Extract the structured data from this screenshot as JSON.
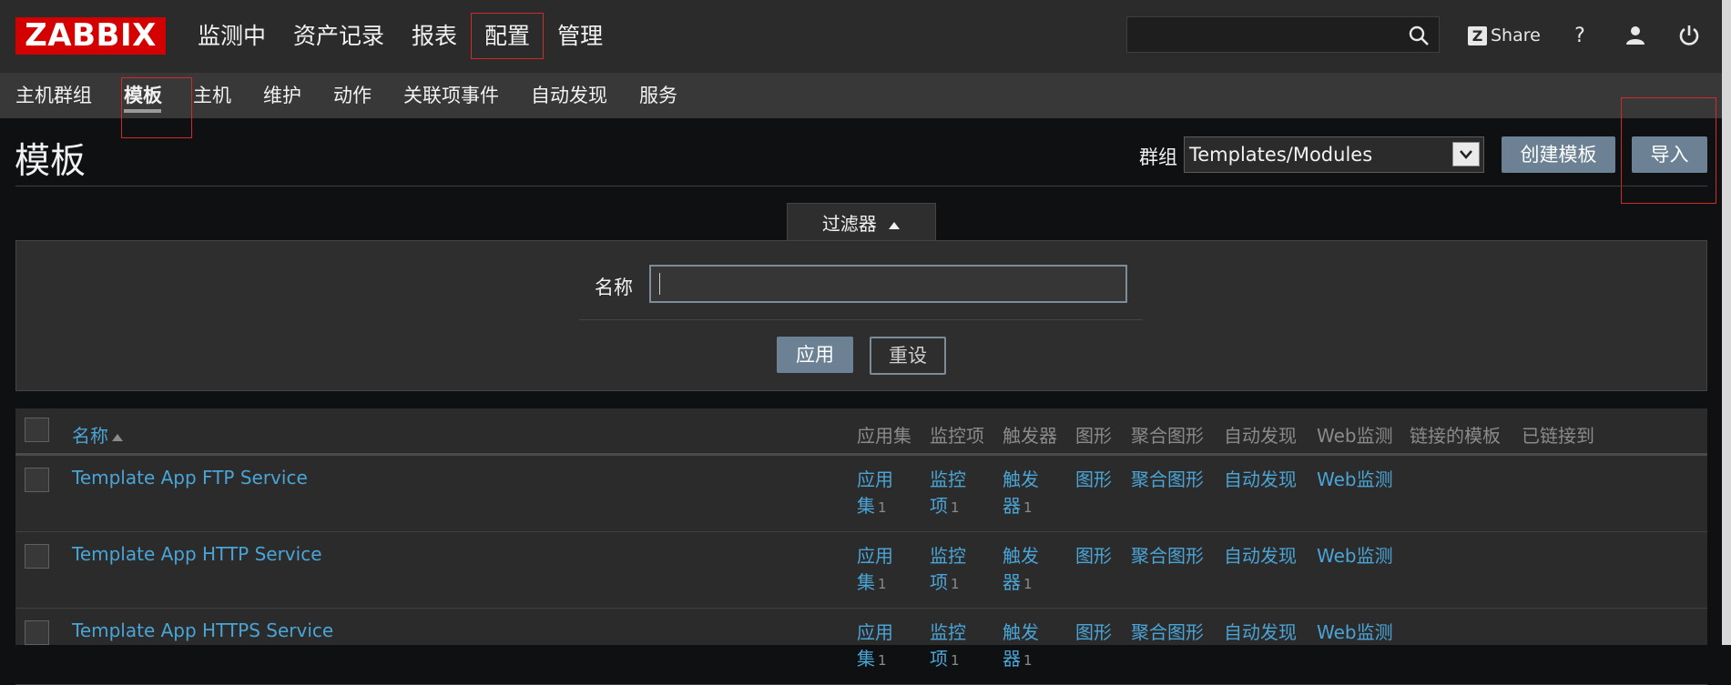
{
  "header": {
    "logo": "ZABBIX",
    "nav": [
      "监测中",
      "资产记录",
      "报表",
      "配置",
      "管理"
    ],
    "active_nav": "配置",
    "search_placeholder": "",
    "share_label": "Share",
    "help_label": "?"
  },
  "subnav": {
    "items": [
      "主机群组",
      "模板",
      "主机",
      "维护",
      "动作",
      "关联项事件",
      "自动发现",
      "服务"
    ],
    "selected": "模板"
  },
  "page": {
    "title": "模板",
    "group_label": "群组",
    "group_value": "Templates/Modules",
    "create_button": "创建模板",
    "import_button": "导入"
  },
  "filter": {
    "tab_label": "过滤器",
    "name_label": "名称",
    "name_value": "",
    "apply_button": "应用",
    "reset_button": "重设"
  },
  "table": {
    "columns": [
      "名称",
      "应用集",
      "监控项",
      "触发器",
      "图形",
      "聚合图形",
      "自动发现",
      "Web监测",
      "链接的模板",
      "已链接到"
    ],
    "rows": [
      {
        "name": "Template App FTP Service",
        "apps": [
          "应用",
          "集"
        ],
        "apps_count": "1",
        "items": [
          "监控",
          "项"
        ],
        "items_count": "1",
        "triggers": [
          "触发",
          "器"
        ],
        "triggers_count": "1",
        "graphs": "图形",
        "screens": "聚合图形",
        "discovery": "自动发现",
        "web": "Web监测"
      },
      {
        "name": "Template App HTTP Service",
        "apps": [
          "应用",
          "集"
        ],
        "apps_count": "1",
        "items": [
          "监控",
          "项"
        ],
        "items_count": "1",
        "triggers": [
          "触发",
          "器"
        ],
        "triggers_count": "1",
        "graphs": "图形",
        "screens": "聚合图形",
        "discovery": "自动发现",
        "web": "Web监测"
      },
      {
        "name": "Template App HTTPS Service",
        "apps": [
          "应用",
          "集"
        ],
        "apps_count": "1",
        "items": [
          "监控",
          "项"
        ],
        "items_count": "1",
        "triggers": [
          "触发",
          "器"
        ],
        "triggers_count": "1",
        "graphs": "图形",
        "screens": "聚合图形",
        "discovery": "自动发现",
        "web": "Web监测"
      }
    ]
  },
  "icons": {
    "search": "search-icon",
    "share": "zabbix-share-icon",
    "user": "user-icon",
    "power": "power-icon",
    "sort": "sort-asc-icon",
    "dropdown": "chevron-down-icon",
    "filter_toggle": "triangle-up-icon"
  },
  "colors": {
    "logo_bg": "#d40000",
    "link": "#4aa4d6",
    "button": "#6c8294",
    "highlight_box": "#d02b2b"
  }
}
